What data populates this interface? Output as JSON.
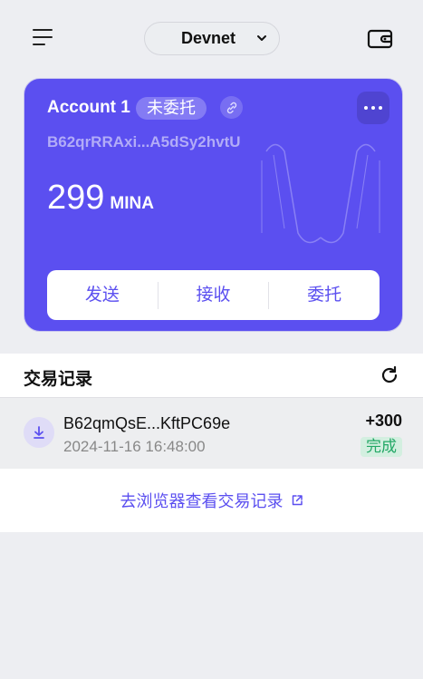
{
  "header": {
    "network": "Devnet",
    "menu_icon": "menu-icon",
    "wallet_icon": "wallet-icon"
  },
  "account": {
    "name": "Account 1",
    "status": "未委托",
    "address": "B62qrRRAxi...A5dSy2hvtU",
    "balance": "299",
    "unit": "MINA",
    "actions": [
      "发送",
      "接收",
      "委托"
    ]
  },
  "transactions": {
    "title": "交易记录",
    "items": [
      {
        "address": "B62qmQsE...KftPC69e",
        "time": "2024-11-16 16:48:00",
        "amount": "+300",
        "status": "完成"
      }
    ],
    "explorer_link": "去浏览器查看交易记录"
  },
  "colors": {
    "accent": "#5b4ff0",
    "success": "#23a866",
    "background": "#edeef2"
  }
}
